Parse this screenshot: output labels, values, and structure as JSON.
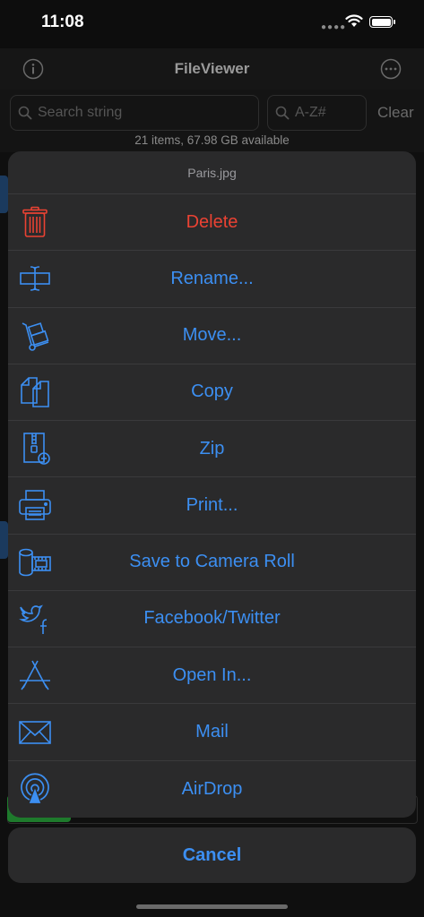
{
  "status": {
    "time": "11:08"
  },
  "nav": {
    "title": "FileViewer",
    "info_icon": "info-circle-icon",
    "more_icon": "ellipsis-circle-icon"
  },
  "search": {
    "placeholder": "Search string",
    "sort_placeholder": "A-Z#",
    "clear_label": "Clear",
    "info": "21 items, 67.98 GB available"
  },
  "sheet": {
    "title": "Paris.jpg",
    "actions": [
      {
        "label": "Delete",
        "icon": "trash-icon",
        "destructive": true
      },
      {
        "label": "Rename...",
        "icon": "text-cursor-icon"
      },
      {
        "label": "Move...",
        "icon": "hand-truck-icon"
      },
      {
        "label": "Copy",
        "icon": "copy-documents-icon"
      },
      {
        "label": "Zip",
        "icon": "zip-file-icon"
      },
      {
        "label": "Print...",
        "icon": "printer-icon"
      },
      {
        "label": "Save to Camera Roll",
        "icon": "film-roll-icon"
      },
      {
        "label": "Facebook/Twitter",
        "icon": "social-bird-icon"
      },
      {
        "label": "Open In...",
        "icon": "app-store-icon"
      },
      {
        "label": "Mail",
        "icon": "envelope-icon"
      },
      {
        "label": "AirDrop",
        "icon": "airdrop-icon"
      }
    ],
    "cancel_label": "Cancel"
  },
  "colors": {
    "accent": "#3c8ff2",
    "destructive": "#ea4233",
    "sheet_bg": "#2a2a2b"
  }
}
